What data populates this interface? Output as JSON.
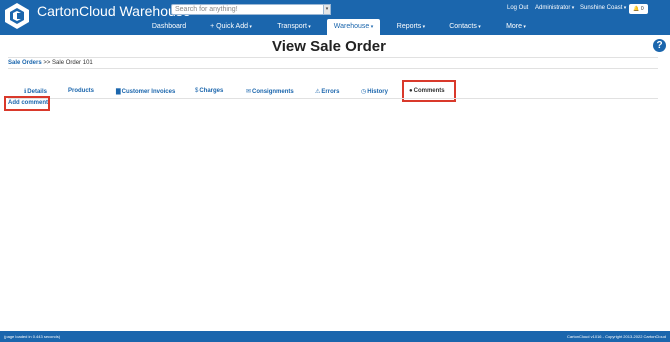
{
  "header": {
    "brand": "CartonCloud Warehouse",
    "search_placeholder": "Search for anything!",
    "logout": "Log Out",
    "user": "Administrator",
    "location": "Sunshine Coast",
    "notifications": "0"
  },
  "nav": {
    "items": [
      {
        "label": "Dashboard"
      },
      {
        "label": "+ Quick Add"
      },
      {
        "label": "Transport"
      },
      {
        "label": "Warehouse"
      },
      {
        "label": "Reports"
      },
      {
        "label": "Contacts"
      },
      {
        "label": "More"
      }
    ]
  },
  "page": {
    "title": "View Sale Order",
    "breadcrumb": {
      "root": "Sale Orders",
      "sep": ">>",
      "current": "Sale Order 101"
    }
  },
  "tabs": [
    {
      "label": "Details",
      "icon": "info-icon"
    },
    {
      "label": "Products",
      "icon": ""
    },
    {
      "label": "Customer Invoices",
      "icon": "document-icon"
    },
    {
      "label": "Charges",
      "icon": "dollar-icon"
    },
    {
      "label": "Consignments",
      "icon": "envelope-icon"
    },
    {
      "label": "Errors",
      "icon": "warning-icon"
    },
    {
      "label": "History",
      "icon": "clock-icon"
    },
    {
      "label": "Comments",
      "icon": "comment-icon"
    }
  ],
  "comments": {
    "add_label": "Add comment"
  },
  "footer": {
    "left": "page loaded in 0.443 seconds",
    "right": "CartonCloud v1016 - Copyright 2013-2022 CartonCloud"
  },
  "colors": {
    "brand": "#1b66ad",
    "highlight": "#d9392b"
  }
}
